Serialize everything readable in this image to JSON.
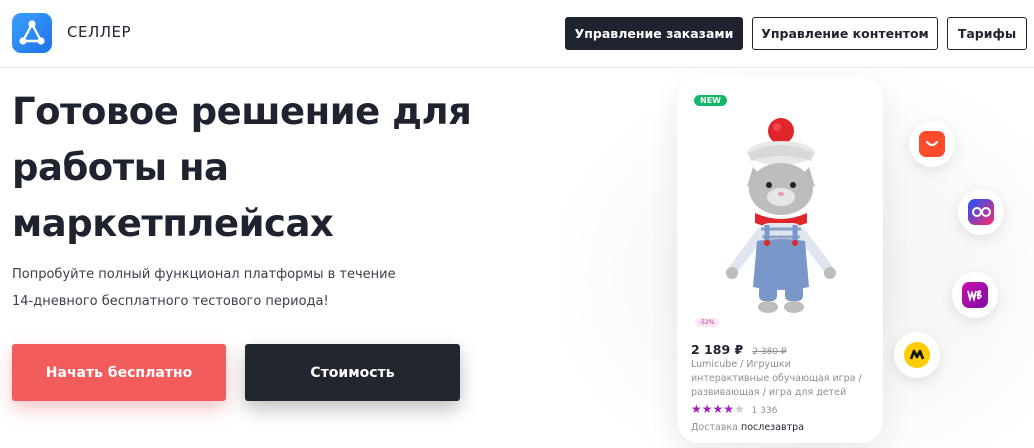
{
  "header": {
    "brand": "СЕЛЛЕР",
    "nav": [
      {
        "label": "Управление заказами",
        "active": true
      },
      {
        "label": "Управление контентом",
        "active": false
      },
      {
        "label": "Тарифы",
        "active": false
      }
    ]
  },
  "hero": {
    "title_lines": [
      "Готовое решение для",
      "работы на",
      "маркетплейсах"
    ],
    "subtitle_lines": [
      "Попробуйте полный функционал платформы в течение",
      "14-дневного бесплатного тестового периода!"
    ],
    "cta_primary": "Начать бесплатно",
    "cta_secondary": "Стоимость"
  },
  "product_card": {
    "badge": "NEW",
    "discount": "-52%",
    "price": "2 189 ₽",
    "old_price": "2 380 ₽",
    "name_lines": [
      "Lumicube / Игрушки",
      "интерактивные обучающая игра /",
      "развивающая / игра для детей"
    ],
    "rating": 4,
    "rating_max": 5,
    "reviews": "1 336",
    "delivery_label": "Доставка",
    "delivery_when": "послезавтра"
  },
  "marketplaces": [
    "aliexpress-icon",
    "ozon-icon",
    "wildberries-icon",
    "yandex-market-icon"
  ],
  "colors": {
    "accent_red": "#f25c5c",
    "dark": "#1f2330",
    "logo_blue": "#1d73e8",
    "rating_purple": "#a020b8",
    "new_badge": "#12b76a"
  }
}
